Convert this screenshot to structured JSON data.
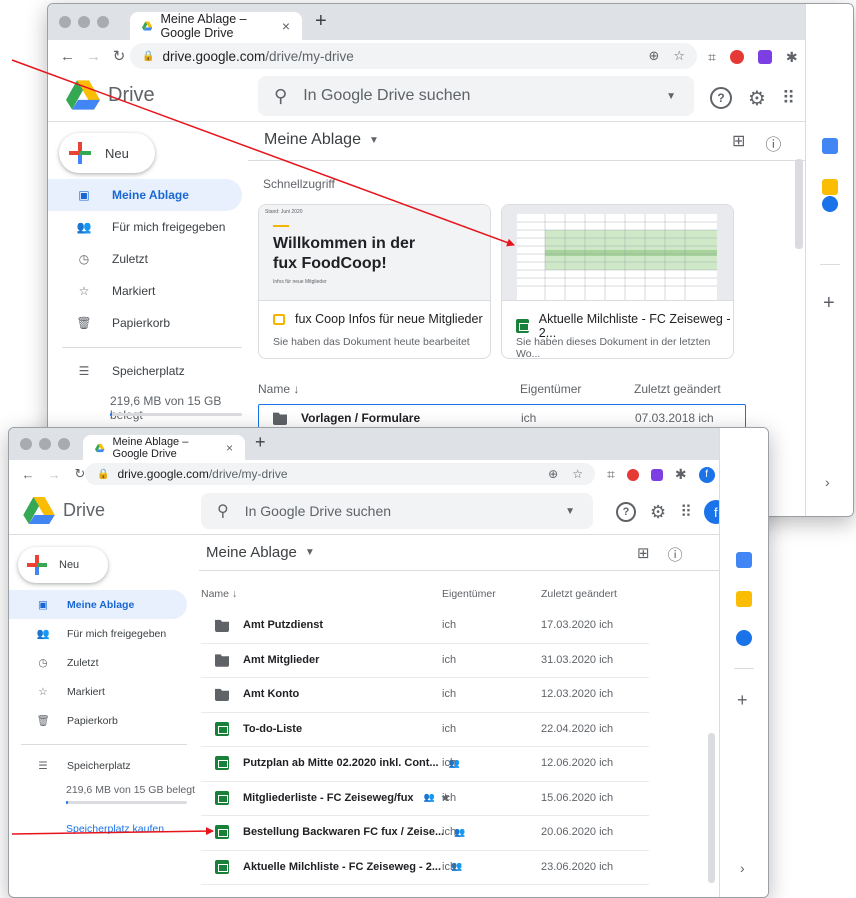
{
  "browser": {
    "tab_title": "Meine Ablage – Google Drive",
    "tab_close": "×",
    "new_tab": "+",
    "url_host": "drive.google.com",
    "url_path": "/drive/my-drive",
    "profile_initial": "f"
  },
  "drive": {
    "logo_text": "Drive",
    "search_placeholder": "In Google Drive suchen",
    "profile_initial": "f",
    "new_button": "Neu"
  },
  "sidebar": {
    "items": [
      {
        "label": "Meine Ablage",
        "icon": "drive-folder-icon",
        "active": true
      },
      {
        "label": "Für mich freigegeben",
        "icon": "shared-people-icon"
      },
      {
        "label": "Zuletzt",
        "icon": "clock-icon"
      },
      {
        "label": "Markiert",
        "icon": "star-icon"
      },
      {
        "label": "Papierkorb",
        "icon": "trash-icon"
      }
    ],
    "storage_label": "Speicherplatz",
    "storage_used": "219,6 MB von 15 GB belegt",
    "storage_fraction": 0.015,
    "buy_storage": "Speicherplatz kaufen"
  },
  "main": {
    "title": "Meine Ablage",
    "quick_access": "Schnellzugriff",
    "cards": [
      {
        "thumb_date": "Stand: Juni 2020",
        "thumb_heading_1": "Willkommen in der",
        "thumb_heading_2": "fux FoodCoop!",
        "thumb_sub": "Infos für neue Mitglieder",
        "name": "fux Coop Infos für neue Mitglieder",
        "desc": "Sie haben das Dokument heute bearbeitet",
        "type": "slides"
      },
      {
        "name": "Aktuelle Milchliste - FC Zeiseweg - 2...",
        "desc": "Sie haben dieses Dokument in der letzten Wo...",
        "type": "sheet"
      }
    ],
    "columns": {
      "name": "Name",
      "sort": "↓",
      "owner": "Eigentümer",
      "modified": "Zuletzt geändert"
    },
    "top_row": {
      "name": "Vorlagen / Formulare",
      "owner": "ich",
      "modified": "07.03.2018 ich"
    },
    "rows": [
      {
        "name": "Amt Putzdienst",
        "type": "folder",
        "owner": "ich",
        "modified": "17.03.2020 ich"
      },
      {
        "name": "Amt Mitglieder",
        "type": "shared-folder",
        "owner": "ich",
        "modified": "31.03.2020 ich"
      },
      {
        "name": "Amt Konto",
        "type": "shared-folder",
        "owner": "ich",
        "modified": "12.03.2020 ich"
      },
      {
        "name": "To-do-Liste",
        "type": "sheet",
        "owner": "ich",
        "modified": "22.04.2020 ich"
      },
      {
        "name": "Putzplan ab Mitte 02.2020 inkl. Cont...",
        "type": "sheet",
        "shared": true,
        "owner": "ich",
        "modified": "12.06.2020 ich"
      },
      {
        "name": "Mitgliederliste - FC Zeiseweg/fux",
        "type": "sheet",
        "shared": true,
        "starred": true,
        "owner": "ich",
        "modified": "15.06.2020 ich"
      },
      {
        "name": "Bestellung Backwaren FC fux / Zeise...",
        "type": "sheet",
        "shared": true,
        "owner": "ich",
        "modified": "20.06.2020 ich"
      },
      {
        "name": "Aktuelle Milchliste - FC Zeiseweg - 2...",
        "type": "sheet",
        "shared": true,
        "owner": "ich",
        "modified": "23.06.2020 ich"
      }
    ]
  },
  "colors": {
    "accent_blue": "#1a73e8",
    "active_bg": "#e8f0fe",
    "sheet_green": "#188038",
    "slides_yellow": "#f4b400",
    "arrow_red": "#e8141c"
  }
}
